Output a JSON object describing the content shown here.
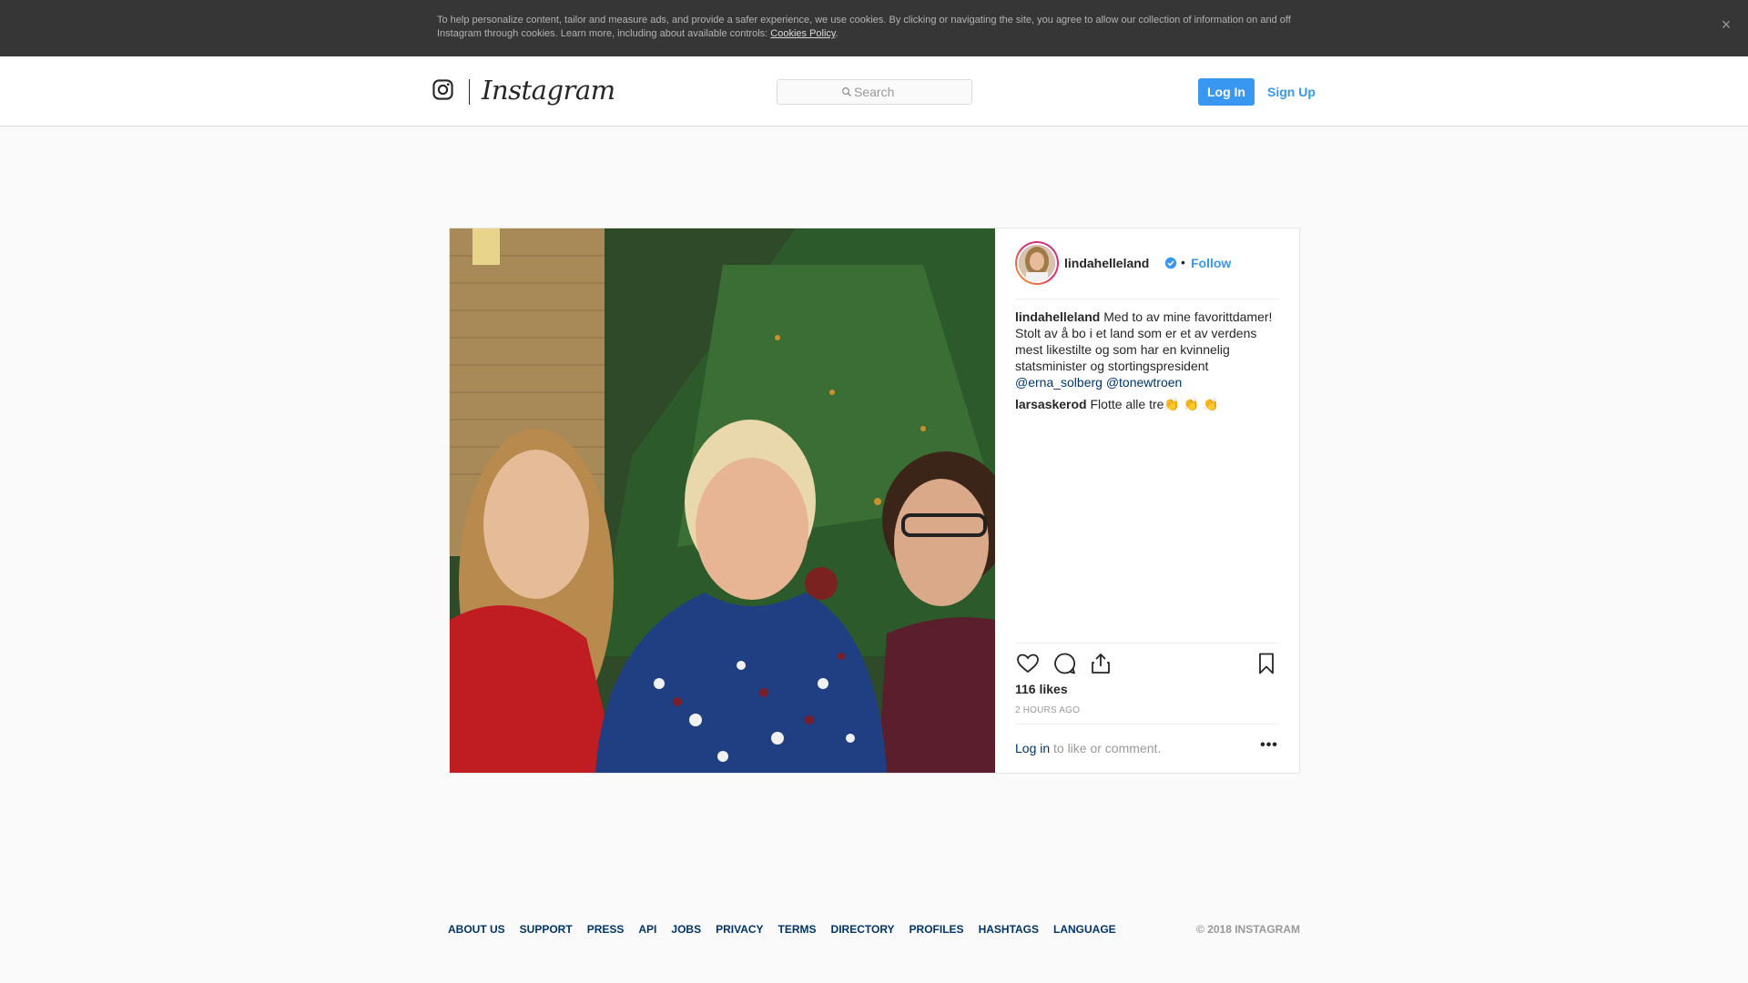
{
  "cookie_banner": {
    "text": "To help personalize content, tailor and measure ads, and provide a safer experience, we use cookies. By clicking or navigating the site, you agree to allow our collection of information on and off Instagram through cookies. Learn more, including about available controls: ",
    "link_label": "Cookies Policy",
    "trailing": ".",
    "close_icon": "×"
  },
  "header": {
    "logo_text": "Instagram",
    "search_placeholder": "Search",
    "login_label": "Log In",
    "signup_label": "Sign Up"
  },
  "post": {
    "username": "lindahelleland",
    "separator": "•",
    "follow_label": "Follow",
    "caption": "Med to av mine favorittdamer! Stolt av å bo i et land som er et av verdens mest likestilte og som har en kvinnelig statsminister og stortingspresident",
    "mention1": "@erna_solberg",
    "mention2": "@tonewtroen",
    "comment_user": "larsaskerod",
    "comment_text": "Flotte alle tre👏 👏 👏",
    "likes": "116 likes",
    "time": "2 hours ago",
    "login_link": "Log in",
    "login_rest": " to like or comment.",
    "more": "•••"
  },
  "footer": {
    "links": [
      "About us",
      "Support",
      "Press",
      "API",
      "Jobs",
      "Privacy",
      "Terms",
      "Directory",
      "Profiles",
      "Hashtags",
      "Language"
    ],
    "copyright": "© 2018 Instagram"
  }
}
